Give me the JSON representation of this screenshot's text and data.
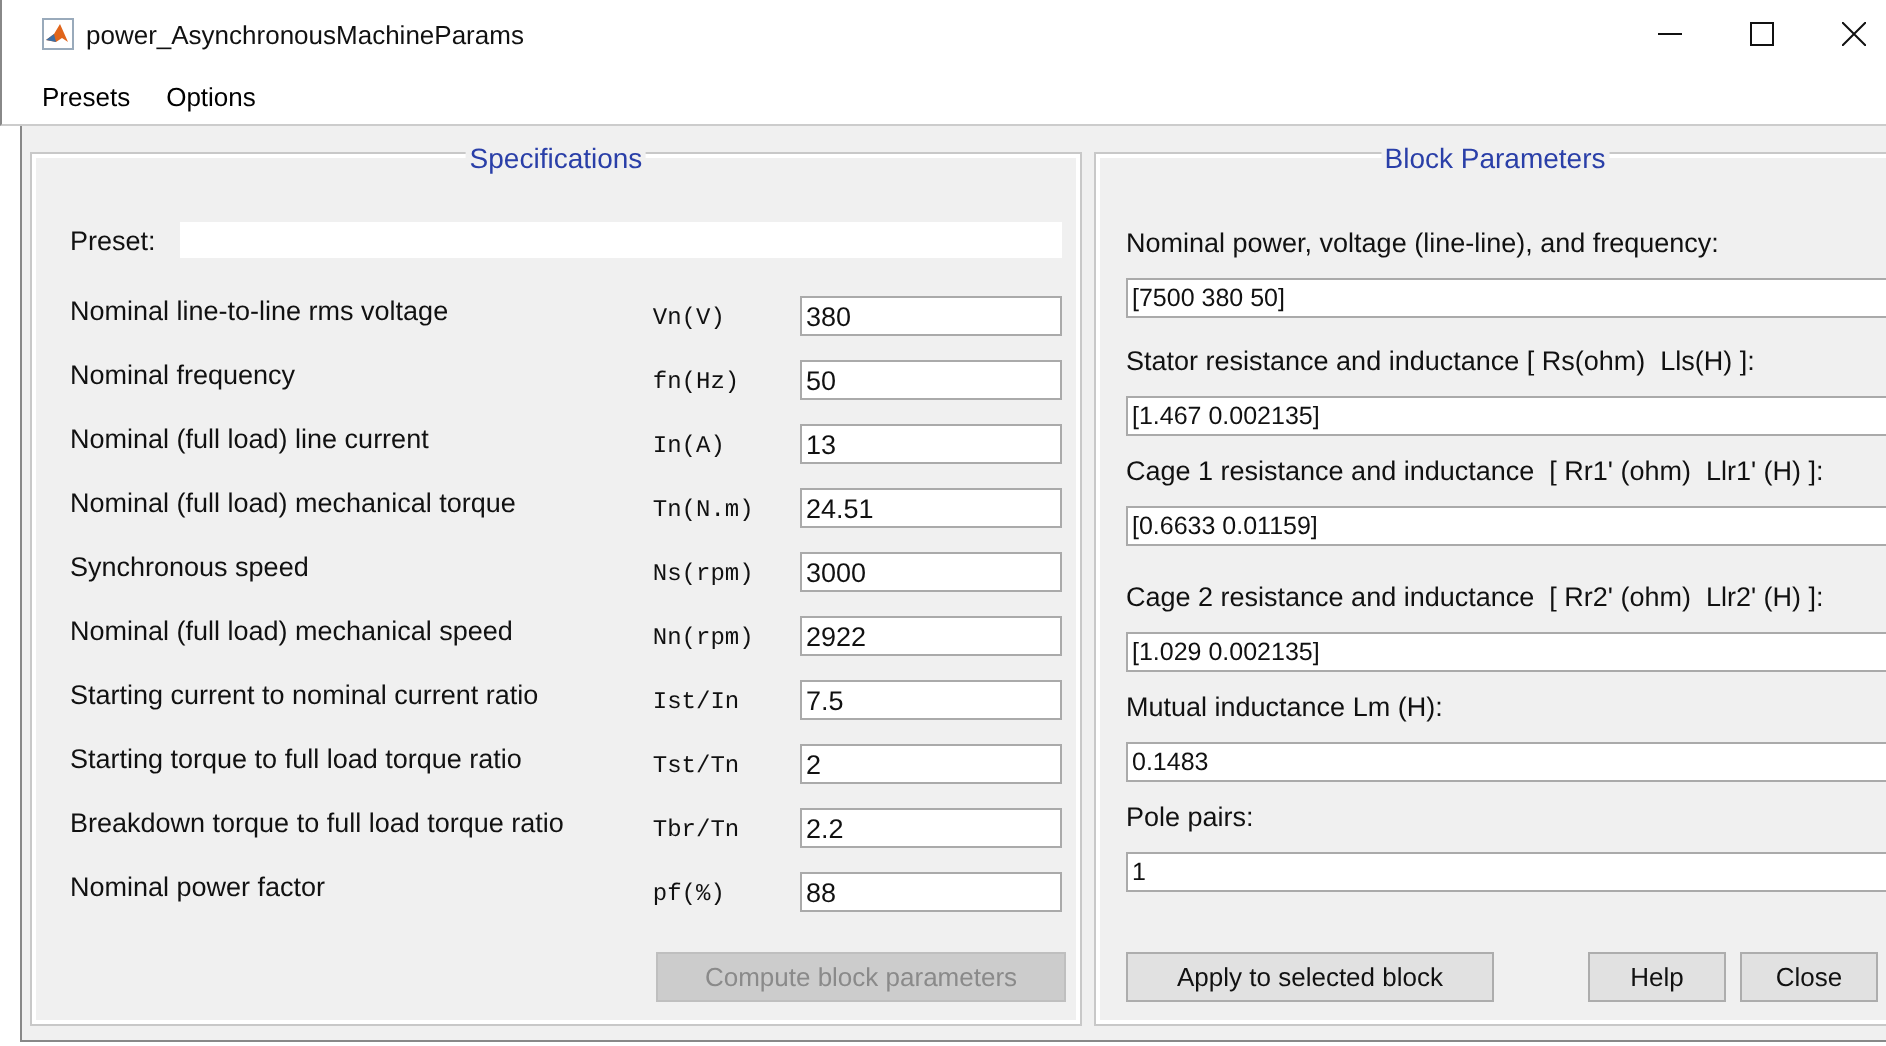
{
  "window": {
    "title": "power_AsynchronousMachineParams"
  },
  "menu": [
    "Presets",
    "Options"
  ],
  "specifications": {
    "title": "Specifications",
    "preset": {
      "label": "Preset:"
    },
    "rows": [
      {
        "label": "Nominal line-to-line rms voltage",
        "symbol": "Vn(V)",
        "value": "380"
      },
      {
        "label": "Nominal frequency",
        "symbol": "fn(Hz)",
        "value": "50"
      },
      {
        "label": "Nominal (full load) line current",
        "symbol": "In(A)",
        "value": "13"
      },
      {
        "label": "Nominal (full load) mechanical torque",
        "symbol": "Tn(N.m)",
        "value": "24.51"
      },
      {
        "label": "Synchronous speed",
        "symbol": "Ns(rpm)",
        "value": "3000"
      },
      {
        "label": "Nominal (full load) mechanical speed",
        "symbol": "Nn(rpm)",
        "value": "2922"
      },
      {
        "label": "Starting current to nominal current ratio",
        "symbol": "Ist/In",
        "value": "7.5"
      },
      {
        "label": "Starting torque to full load torque ratio",
        "symbol": "Tst/Tn",
        "value": "2"
      },
      {
        "label": "Breakdown torque to full load torque ratio",
        "symbol": "Tbr/Tn",
        "value": "2.2"
      },
      {
        "label": "Nominal power factor",
        "symbol": "pf(%)",
        "value": "88"
      }
    ],
    "compute_button": {
      "label": "Compute block parameters",
      "disabled": true
    }
  },
  "block_parameters": {
    "title": "Block Parameters",
    "fields": [
      {
        "label": "Nominal power, voltage (line-line), and frequency:",
        "value": "[7500 380 50]"
      },
      {
        "label": "Stator resistance and inductance [ Rs(ohm)  Lls(H) ]:",
        "value": "[1.467 0.002135]"
      },
      {
        "label": "Cage 1 resistance and inductance  [ Rr1' (ohm)  Llr1' (H) ]:",
        "value": "[0.6633 0.01159]"
      },
      {
        "label": "Cage 2 resistance and inductance  [ Rr2' (ohm)  Llr2' (H) ]:",
        "value": "[1.029 0.002135]"
      },
      {
        "label": "Mutual inductance Lm (H):",
        "value": "0.1483"
      },
      {
        "label": "Pole pairs:",
        "value": "1"
      }
    ],
    "buttons": [
      "Apply to selected block",
      "Help",
      "Close"
    ]
  }
}
